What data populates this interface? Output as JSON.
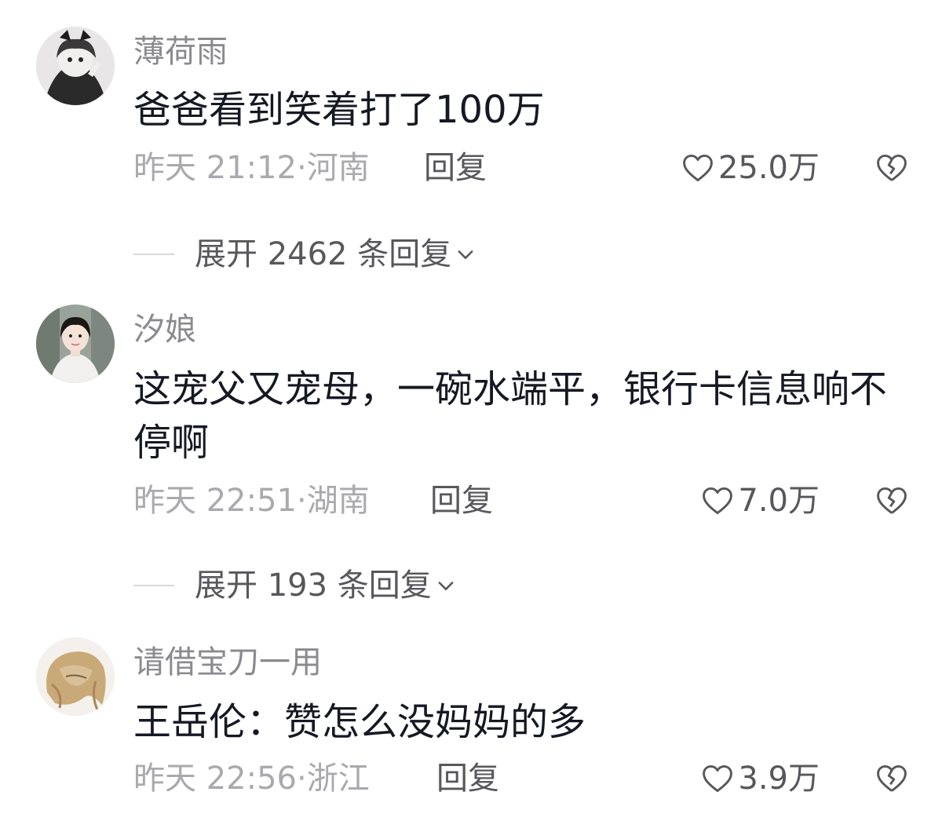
{
  "comments": [
    {
      "username": "薄荷雨",
      "content": "爸爸看到笑着打了100万",
      "time_location": "昨天 21:12·河南",
      "reply_label": "回复",
      "likes": "25.0万",
      "expand_label": "展开 2462 条回复"
    },
    {
      "username": "汐娘",
      "content": "这宠父又宠母，一碗水端平，银行卡信息响不停啊",
      "time_location": "昨天 22:51·湖南",
      "reply_label": "回复",
      "likes": "7.0万",
      "expand_label": "展开 193 条回复"
    },
    {
      "username": "请借宝刀一用",
      "content": "王岳伦：赞怎么没妈妈的多",
      "time_location": "昨天 22:56·浙江",
      "reply_label": "回复",
      "likes": "3.9万"
    }
  ],
  "icons": {
    "like": "heart-outline-icon",
    "dislike": "broken-heart-icon",
    "expand": "chevron-down-icon"
  },
  "colors": {
    "text_primary": "#161823",
    "text_secondary": "#8a8a8f",
    "text_meta": "#a9a9ae",
    "text_action": "#57575c",
    "divider": "#d8d8dc"
  }
}
